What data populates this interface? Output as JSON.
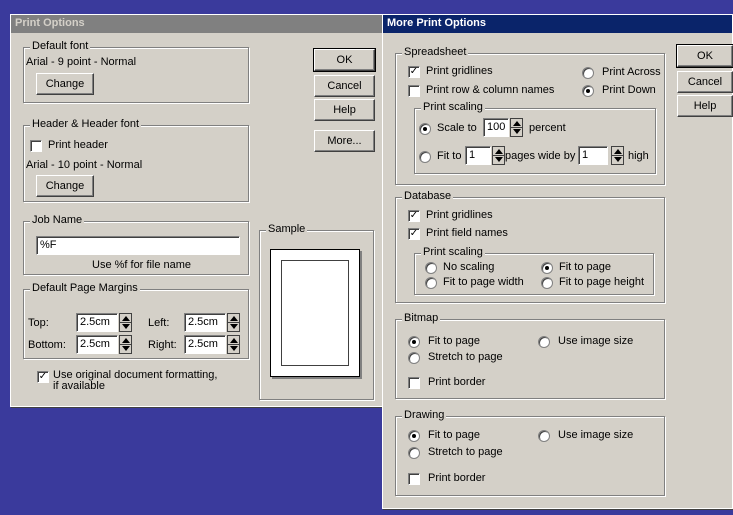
{
  "colors": {
    "desktop": "#3a3a9c",
    "titlebar_inactive": "#808080",
    "titlebar_active": "#0a246a",
    "dialog_face": "#d4d0c8"
  },
  "print_options": {
    "title": "Print Options",
    "default_font": {
      "legend": "Default font",
      "value": "Arial - 9 point - Normal",
      "change_label": "Change"
    },
    "header_font": {
      "legend": "Header & Header font",
      "print_header_label": "Print header",
      "print_header_checked": false,
      "value": "Arial - 10 point - Normal",
      "change_label": "Change"
    },
    "job_name": {
      "legend": "Job Name",
      "value": "%F",
      "hint": "Use %f for file name"
    },
    "margins": {
      "legend": "Default Page Margins",
      "top_label": "Top:",
      "top_value": "2.5cm",
      "left_label": "Left:",
      "left_value": "2.5cm",
      "bottom_label": "Bottom:",
      "bottom_value": "2.5cm",
      "right_label": "Right:",
      "right_value": "2.5cm"
    },
    "use_original_label": "Use original document formatting, if available",
    "use_original_checked": true,
    "sample_legend": "Sample",
    "buttons": {
      "ok": "OK",
      "cancel": "Cancel",
      "help": "Help",
      "more": "More..."
    }
  },
  "more_print_options": {
    "title": "More Print Options",
    "spreadsheet": {
      "legend": "Spreadsheet",
      "print_gridlines": "Print gridlines",
      "print_gridlines_checked": true,
      "print_names": "Print row & column names",
      "print_names_checked": false,
      "print_across": "Print Across",
      "print_down": "Print Down",
      "order_selected": "Print Down",
      "scaling": {
        "legend": "Print scaling",
        "scale_to": "Scale to",
        "scale_value": "100",
        "percent": "percent",
        "fit_to": "Fit to",
        "wide_value": "1",
        "pages_wide_by": "pages wide by",
        "high_value": "1",
        "high": "high",
        "selected": "Scale to"
      }
    },
    "database": {
      "legend": "Database",
      "print_gridlines": "Print gridlines",
      "print_gridlines_checked": true,
      "print_field_names": "Print field names",
      "print_field_names_checked": true,
      "scaling": {
        "legend": "Print scaling",
        "no_scaling": "No scaling",
        "fit_to_page": "Fit to page",
        "fit_width": "Fit to page width",
        "fit_height": "Fit to page height",
        "selected": "Fit to page"
      }
    },
    "bitmap": {
      "legend": "Bitmap",
      "fit_to_page": "Fit to page",
      "use_image_size": "Use image size",
      "stretch_to_page": "Stretch to page",
      "selected": "Fit to page",
      "print_border": "Print border",
      "print_border_checked": false
    },
    "drawing": {
      "legend": "Drawing",
      "fit_to_page": "Fit to page",
      "use_image_size": "Use image size",
      "stretch_to_page": "Stretch to page",
      "selected": "Fit to page",
      "print_border": "Print border",
      "print_border_checked": false
    },
    "buttons": {
      "ok": "OK",
      "cancel": "Cancel",
      "help": "Help"
    }
  }
}
